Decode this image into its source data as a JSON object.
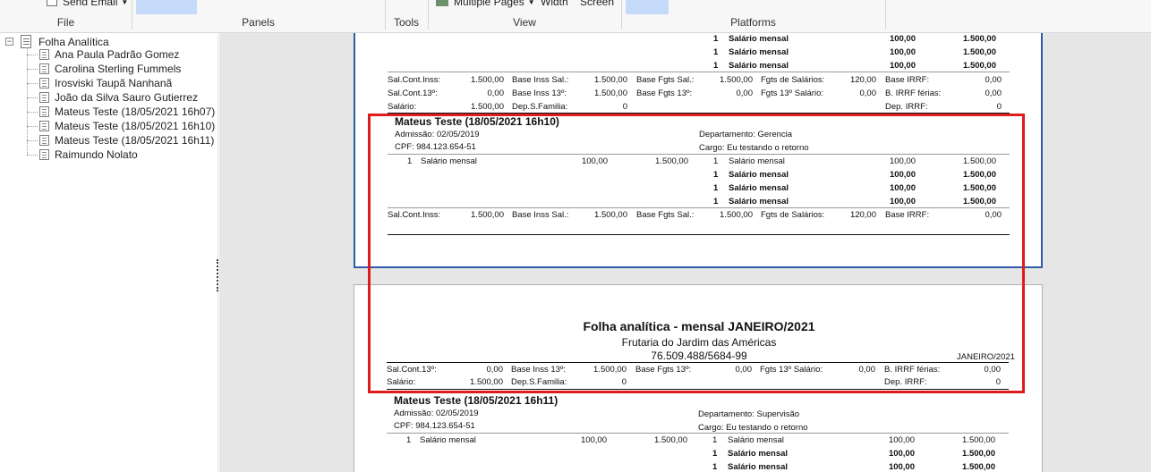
{
  "ribbon": {
    "send_email": "Send Email",
    "multiple_pages": "Multiple Pages",
    "width": "Width",
    "screen": "Screen",
    "groups": {
      "file": "File",
      "panels": "Panels",
      "tools": "Tools",
      "view": "View",
      "platforms": "Platforms"
    }
  },
  "tree": {
    "root": "Folha Analítica",
    "root_expander": "−",
    "items": [
      "Ana Paula Padrão Gomez",
      "Carolina Sterling Fummels",
      "Irosviski Taupã Nanhanã",
      "João da Silva Sauro Gutierrez",
      "Mateus Teste (18/05/2021 16h07)",
      "Mateus Teste (18/05/2021 16h10)",
      "Mateus Teste (18/05/2021 16h11)",
      "Raimundo Nolato"
    ]
  },
  "page1": {
    "top_rows": [
      {
        "n": "1",
        "desc": "Salário mensal",
        "qty": "100,00",
        "val": "1.500,00"
      },
      {
        "n": "1",
        "desc": "Salário mensal",
        "qty": "100,00",
        "val": "1.500,00"
      },
      {
        "n": "1",
        "desc": "Salário mensal",
        "qty": "100,00",
        "val": "1.500,00"
      }
    ],
    "summary": {
      "r1": [
        "Sal.Cont.Inss:",
        "1.500,00",
        "Base Inss Sal.:",
        "1.500,00",
        "Base Fgts Sal.:",
        "1.500,00",
        "Fgts de Salários:",
        "120,00",
        "Base IRRF:",
        "0,00"
      ],
      "r2": [
        "Sal.Cont.13º:",
        "0,00",
        "Base Inss 13º:",
        "1.500,00",
        "Base Fgts 13º:",
        "0,00",
        "Fgts 13º Salário:",
        "0,00",
        "B. IRRF férias:",
        "0,00"
      ],
      "r3": [
        "Salário:",
        "1.500,00",
        "Dep.S.Familia:",
        "0",
        "Dep. IRRF:",
        "0"
      ]
    },
    "employee": {
      "name": "Mateus Teste (18/05/2021 16h10)",
      "admissao": "Admissão: 02/05/2019",
      "cpf": "CPF: 984.123.654-51",
      "departamento": "Departamento: Gerencia",
      "cargo": "Cargo: Eu testando o retorno",
      "line_left": {
        "n": "1",
        "desc": "Salário mensal",
        "qty": "100,00",
        "val": "1.500,00"
      },
      "lines_right": [
        {
          "n": "1",
          "desc": "Salário mensal",
          "qty": "100,00",
          "val": "1.500,00",
          "bold": false
        },
        {
          "n": "1",
          "desc": "Salário mensal",
          "qty": "100,00",
          "val": "1.500,00",
          "bold": true
        },
        {
          "n": "1",
          "desc": "Salário mensal",
          "qty": "100,00",
          "val": "1.500,00",
          "bold": true
        },
        {
          "n": "1",
          "desc": "Salário mensal",
          "qty": "100,00",
          "val": "1.500,00",
          "bold": true
        }
      ],
      "summary": [
        "Sal.Cont.Inss:",
        "1.500,00",
        "Base Inss Sal.:",
        "1.500,00",
        "Base Fgts Sal.:",
        "1.500,00",
        "Fgts de Salários:",
        "120,00",
        "Base IRRF:",
        "0,00"
      ]
    }
  },
  "page2": {
    "title": "Folha analítica - mensal JANEIRO/2021",
    "company": "Frutaria do Jardim das Américas",
    "cnpj": "76.509.488/5684-99",
    "period": "JANEIRO/2021",
    "summary": {
      "r1": [
        "Sal.Cont.13º:",
        "0,00",
        "Base Inss 13º:",
        "1.500,00",
        "Base Fgts 13º:",
        "0,00",
        "Fgts 13º Salário:",
        "0,00",
        "B. IRRF férias:",
        "0,00"
      ],
      "r2": [
        "Salário:",
        "1.500,00",
        "Dep.S.Familia:",
        "0",
        "Dep. IRRF:",
        "0"
      ]
    },
    "employee": {
      "name": "Mateus Teste (18/05/2021 16h11)",
      "admissao": "Admissão: 02/05/2019",
      "cpf": "CPF: 984.123.654-51",
      "departamento": "Departamento: Supervisão",
      "cargo": "Cargo: Eu testando o retorno",
      "line_left": {
        "n": "1",
        "desc": "Salário mensal",
        "qty": "100,00",
        "val": "1.500,00"
      },
      "lines_right": [
        {
          "n": "1",
          "desc": "Salário mensal",
          "qty": "100,00",
          "val": "1.500,00",
          "bold": false
        },
        {
          "n": "1",
          "desc": "Salário mensal",
          "qty": "100,00",
          "val": "1.500,00",
          "bold": true
        },
        {
          "n": "1",
          "desc": "Salário mensal",
          "qty": "100,00",
          "val": "1.500,00",
          "bold": true
        }
      ]
    }
  },
  "colors": {
    "highlight": "#e01b1b",
    "selected_page_border": "#2f5ca8",
    "ribbon_selection": "#c5daf9"
  }
}
